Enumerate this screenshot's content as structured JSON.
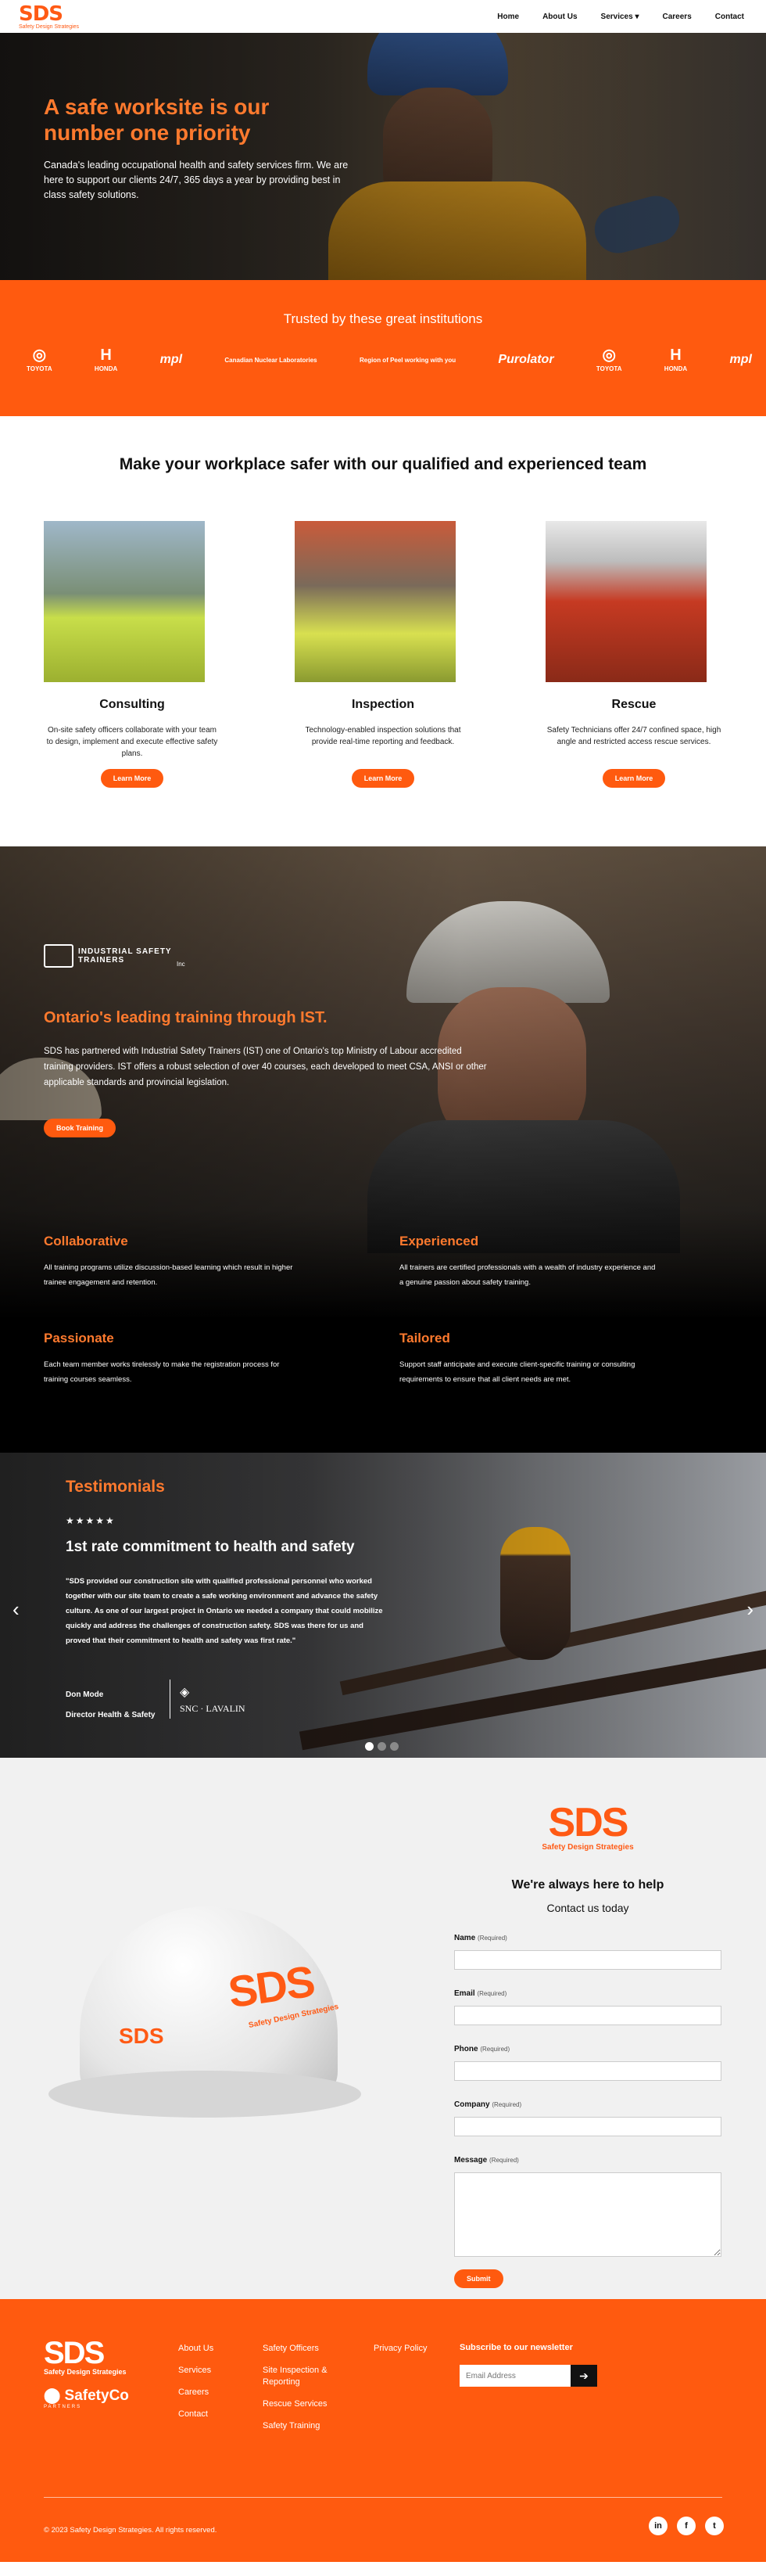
{
  "nav": {
    "logo": "SDS",
    "logo_sub": "Safety Design Strategies",
    "items": [
      "Home",
      "About Us",
      "Services",
      "Careers",
      "Contact"
    ]
  },
  "hero": {
    "title": "A safe worksite is our number one priority",
    "text": "Canada's leading occupational health and safety services firm. We are here to support our clients 24/7, 365 days a year by providing best in class safety solutions."
  },
  "trusted": {
    "title": "Trusted by these great institutions",
    "logos": [
      "TOYOTA",
      "HONDA",
      "mpl",
      "Canadian Nuclear Laboratories",
      "Region of Peel working with you",
      "Purolator",
      "TOYOTA",
      "HONDA",
      "mpl"
    ]
  },
  "team": {
    "title": "Make your workplace safer with our qualified and experienced team",
    "cards": [
      {
        "title": "Consulting",
        "text": "On-site safety officers collaborate with your team to design, implement and execute effective safety plans.",
        "button": "Learn More"
      },
      {
        "title": "Inspection",
        "text": "Technology-enabled inspection solutions that provide real-time reporting and feedback.",
        "button": "Learn More"
      },
      {
        "title": "Rescue",
        "text": "Safety Technicians offer 24/7 confined space, high angle and restricted access rescue services.",
        "button": "Learn More"
      }
    ]
  },
  "ist": {
    "logo_text": "INDUSTRIAL SAFETY TRAINERS",
    "logo_inc": "Inc",
    "title": "Ontario's leading training through IST.",
    "text": "SDS has partnered with Industrial Safety Trainers (IST) one of Ontario's top Ministry of Labour accredited training providers. IST offers a robust selection of over 40 courses, each developed to meet CSA, ANSI or other applicable standards and provincial legislation.",
    "button": "Book Training",
    "features": [
      {
        "title": "Collaborative",
        "text": "All training programs utilize discussion-based learning which result in higher trainee engagement and retention."
      },
      {
        "title": "Experienced",
        "text": "All trainers are certified professionals with a wealth of industry experience and a genuine passion about safety training."
      },
      {
        "title": "Passionate",
        "text": "Each team member works tirelessly to make the registration process for training courses seamless."
      },
      {
        "title": "Tailored",
        "text": "Support staff anticipate and execute client-specific training or consulting requirements to ensure that all client needs are met."
      }
    ]
  },
  "testimonials": {
    "title": "Testimonials",
    "stars": "★★★★★",
    "heading": "1st rate commitment to health and safety",
    "quote": "\"SDS provided our construction site with qualified professional personnel who worked together with our site team to create a safe working environment and advance the safety culture. As one of our largest project in Ontario we needed a company that could mobilize quickly and address the challenges of construction safety. SDS was there for us and proved that their commitment to health and safety was first rate.\"",
    "name": "Don Mode",
    "role": "Director Health & Safety",
    "company": "SNC · LAVALIN"
  },
  "contact": {
    "logo": "SDS",
    "logo_sub": "Safety Design Strategies",
    "title": "We're always here to help",
    "subtitle": "Contact us today",
    "required": "(Required)",
    "fields": [
      "Name",
      "Email",
      "Phone",
      "Company",
      "Message"
    ],
    "submit": "Submit",
    "helmet_logo": "SDS",
    "helmet_sub": "Safety Design Strategies"
  },
  "footer": {
    "logo": "SDS",
    "logo_sub": "Safety Design Strategies",
    "partner": "SafetyCo",
    "partner_sub": "PARTNERS",
    "col1": [
      "About Us",
      "Services",
      "Careers",
      "Contact"
    ],
    "col2": [
      "Safety Officers",
      "Site Inspection & Reporting",
      "Rescue Services",
      "Safety Training"
    ],
    "col3": [
      "Privacy Policy"
    ],
    "newsletter_title": "Subscribe to our newsletter",
    "email_placeholder": "Email Address",
    "copyright": "© 2023 Safety Design Strategies. All rights reserved.",
    "social": [
      "in",
      "f",
      "t"
    ]
  },
  "colors": {
    "accent": "#ff5a0f"
  }
}
